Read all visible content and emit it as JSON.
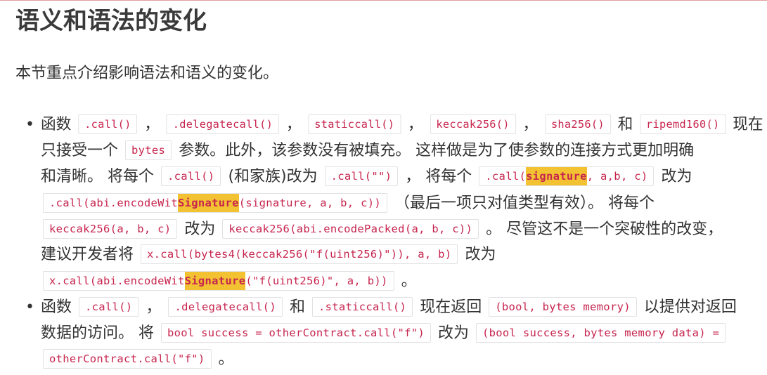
{
  "heading": "语义和语法的变化",
  "intro": "本节重点介绍影响语法和语义的变化。",
  "bullet_char": "•",
  "item1": {
    "l1": {
      "t1": "函数",
      "c1": ".call()",
      "t2": "，",
      "c2": ".delegatecall()",
      "t3": "，",
      "c3": "staticcall()",
      "t4": "，",
      "c4": "keccak256()",
      "t5": "，",
      "c5": "sha256()",
      "t6": "和",
      "c6": "ripemd160()",
      "t7": "现在"
    },
    "l2": {
      "t1": "只接受一个",
      "c1": "bytes",
      "t2": "参数。此外，该参数没有被填充。 这样做是为了使参数的连接方式更加明确"
    },
    "l3": {
      "t1": "和清晰。 将每个",
      "c1": ".call()",
      "t2": "(和家族)改为",
      "c2": ".call(\"\")",
      "t3": "， 将每个",
      "c3a": ".call(",
      "c3hl": "signature",
      "c3b": ", a,b, c)",
      "t4": "改为"
    },
    "l4": {
      "c1a": ".call(abi.encodeWit",
      "c1hl": "Signature",
      "c1b": "(signature, a, b, c))",
      "t1": "（最后一项只对值类型有效）。 将每个"
    },
    "l5": {
      "c1": "keccak256(a, b, c)",
      "t1": "改为",
      "c2": "keccak256(abi.encodePacked(a, b, c))",
      "t2": "。 尽管这不是一个突破性的改变，"
    },
    "l6": {
      "t1": "建议开发者将",
      "c1": "x.call(bytes4(keccak256(\"f(uint256)\")), a, b)",
      "t2": "改为"
    },
    "l7": {
      "c1a": "x.call(abi.encodeWit",
      "c1hl": "Signature",
      "c1b": "(\"f(uint256)\", a, b))",
      "t1": "。"
    }
  },
  "item2": {
    "l1": {
      "t1": "函数",
      "c1": ".call()",
      "t2": "，",
      "c2": ".delegatecall()",
      "t3": "和",
      "c3": ".staticcall()",
      "t4": "现在返回",
      "c4": "(bool, bytes memory)",
      "t5": "以提供对返回"
    },
    "l2": {
      "t1": "数据的访问。 将",
      "c1": "bool success = otherContract.call(\"f\")",
      "t2": "改为",
      "c2": "(bool success, bytes memory data) ="
    },
    "l3": {
      "c1": "otherContract.call(\"f\")",
      "t1": "。"
    }
  },
  "colors": {
    "code_text": "#c7254e",
    "highlight": "#f2c232",
    "heading": "#3a3a3a"
  }
}
